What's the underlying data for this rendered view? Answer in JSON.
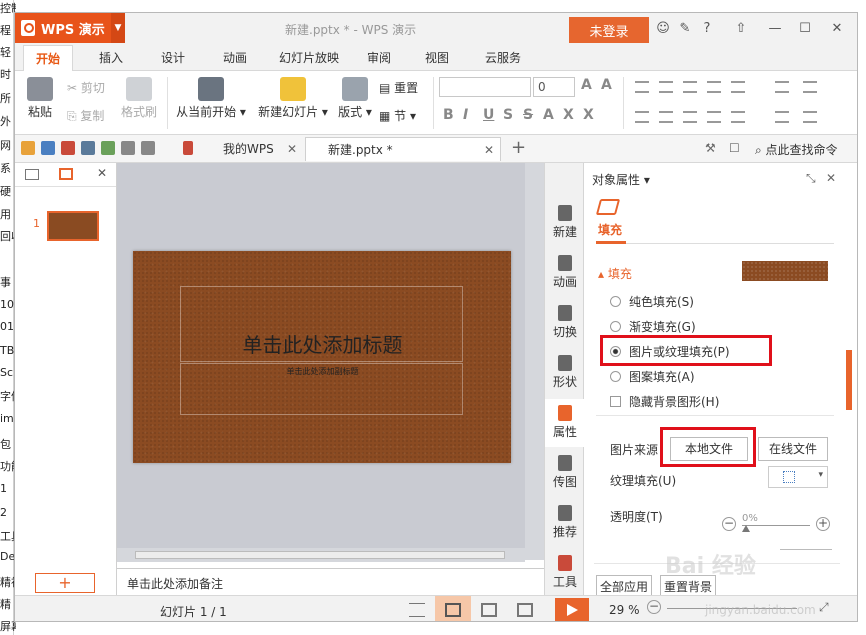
{
  "left_sidebar_fragments": [
    "控制面板",
    "程",
    "轻",
    "时",
    "所",
    "外",
    "网",
    "系",
    "硬",
    "用",
    "回收",
    "事",
    "10",
    "01",
    "TB",
    "Sc",
    "字体",
    "im",
    "包",
    "功能",
    "1",
    "2",
    "工具",
    "De",
    "精神",
    "精",
    "屏幕检测上位机"
  ],
  "titlebar": {
    "app_name": "WPS 演示",
    "document_title": "新建.pptx * - WPS 演示",
    "login_label": "未登录",
    "help_label": "?"
  },
  "tabs": [
    "开始",
    "插入",
    "设计",
    "动画",
    "幻灯片放映",
    "审阅",
    "视图",
    "云服务"
  ],
  "ribbon": {
    "paste": "粘贴",
    "cut": "剪切",
    "copy": "复制",
    "format_painter": "格式刷",
    "from_current": "从当前开始",
    "new_slide": "新建幻灯片",
    "layout": "版式",
    "reset": "重置",
    "section": "节",
    "font_size": "0"
  },
  "doctabs": {
    "mywps": "我的WPS",
    "file": "新建.pptx *",
    "search": "点此查找命令"
  },
  "thumbnail": {
    "number": "1"
  },
  "slide": {
    "title_placeholder": "单击此处添加标题",
    "subtitle_placeholder": "单击此处添加副标题",
    "notes_placeholder": "单击此处添加备注"
  },
  "side_tools": [
    "新建",
    "动画",
    "切换",
    "形状",
    "属性",
    "传图",
    "推荐",
    "工具"
  ],
  "panel": {
    "header": "对象属性",
    "tab": "填充",
    "section": "填充",
    "options": [
      "纯色填充(S)",
      "渐变填充(G)",
      "图片或纹理填充(P)",
      "图案填充(A)"
    ],
    "selected_option": "图片或纹理填充(P)",
    "hide_bg": "隐藏背景图形(H)",
    "source_label": "图片来源",
    "local_file": "本地文件",
    "online_file": "在线文件",
    "texture_label": "纹理填充(U)",
    "transparency_label": "透明度(T)",
    "transparency_value": "0%",
    "apply_all": "全部应用",
    "reset_bg": "重置背景"
  },
  "status": {
    "slide_count": "幻灯片 1 / 1",
    "zoom": "29 %"
  },
  "watermark": {
    "main": "Bai 经验",
    "sub": "jingyan.baidu.com"
  }
}
